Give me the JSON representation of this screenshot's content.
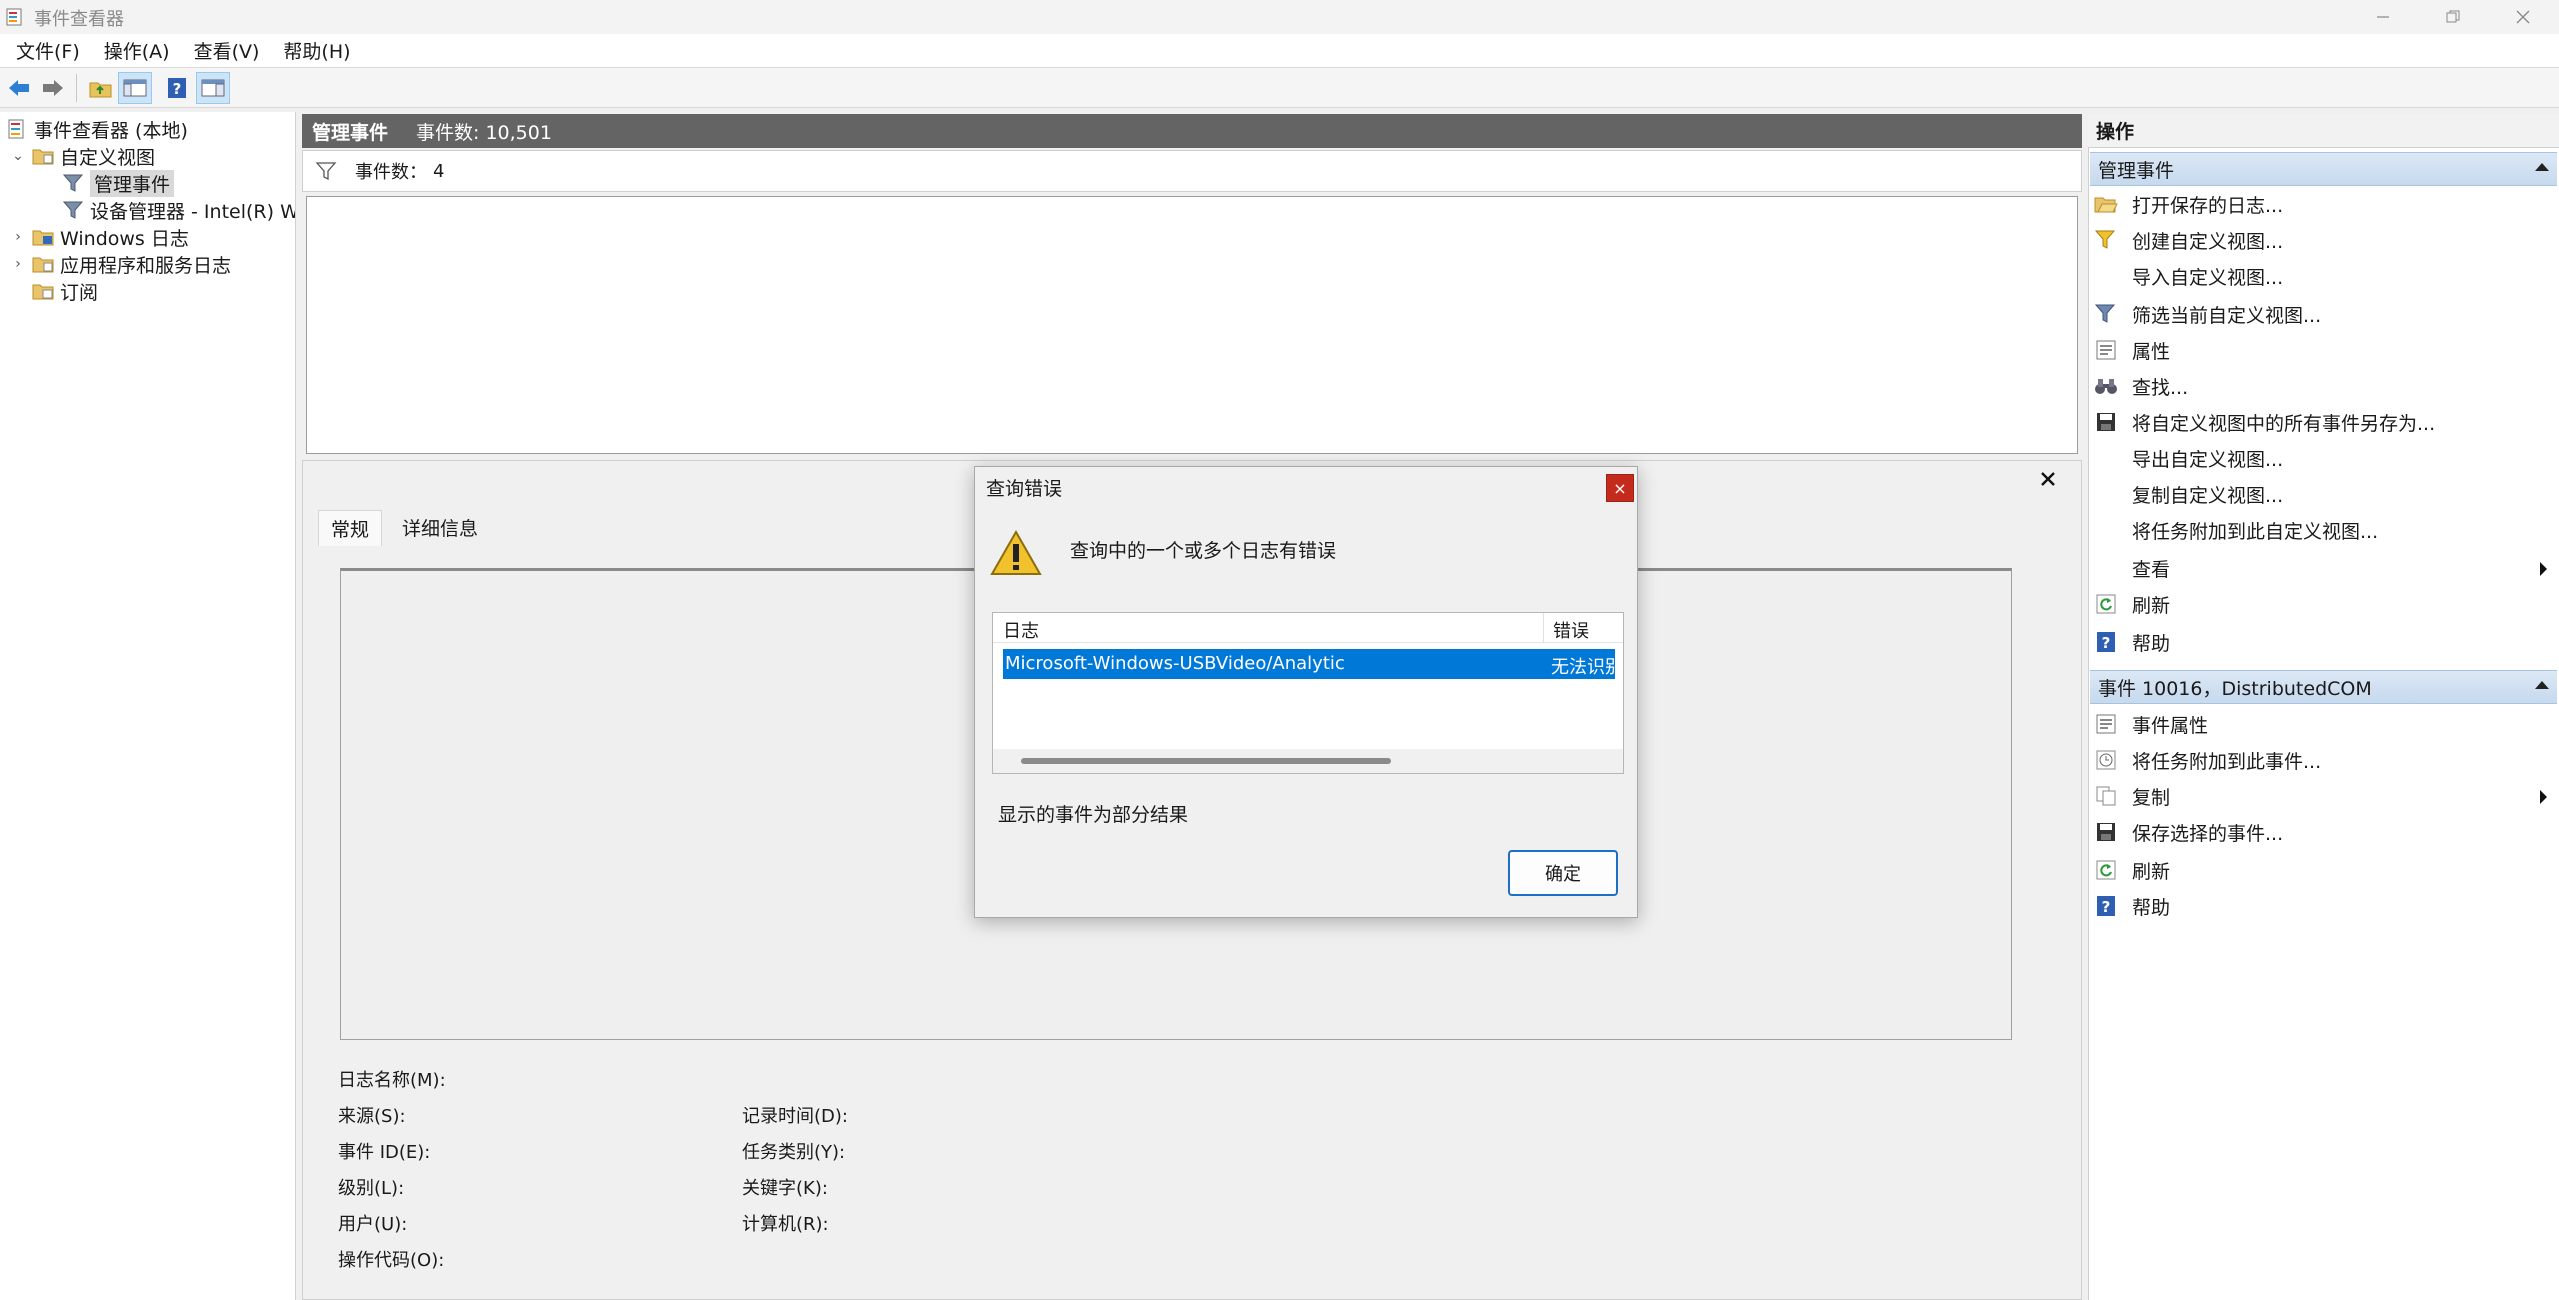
{
  "window": {
    "title": "事件查看器"
  },
  "menu": [
    "文件(F)",
    "操作(A)",
    "查看(V)",
    "帮助(H)"
  ],
  "tree": {
    "root": "事件查看器 (本地)",
    "custom_views": "自定义视图",
    "admin_events": "管理事件",
    "device_manager": "设备管理器 - Intel(R) Wi-",
    "windows_logs": "Windows 日志",
    "app_service_logs": "应用程序和服务日志",
    "subscriptions": "订阅"
  },
  "center": {
    "header_title": "管理事件",
    "header_count": "事件数: 10,501",
    "filter_label": "事件数：",
    "filter_count": "4"
  },
  "detail": {
    "tabs": [
      "常规",
      "详细信息"
    ],
    "fields": {
      "log_name": "日志名称(M):",
      "source": "来源(S):",
      "event_id": "事件 ID(E):",
      "level": "级别(L):",
      "user": "用户(U):",
      "opcode": "操作代码(O):",
      "logged": "记录时间(D):",
      "task_category": "任务类别(Y):",
      "keywords": "关键字(K):",
      "computer": "计算机(R):"
    }
  },
  "actions": {
    "title": "操作",
    "section1": "管理事件",
    "section1_items": [
      "打开保存的日志...",
      "创建自定义视图...",
      "导入自定义视图...",
      "筛选当前自定义视图...",
      "属性",
      "查找...",
      "将自定义视图中的所有事件另存为...",
      "导出自定义视图...",
      "复制自定义视图...",
      "将任务附加到此自定义视图...",
      "查看",
      "刷新",
      "帮助"
    ],
    "section2": "事件 10016，DistributedCOM",
    "section2_items": [
      "事件属性",
      "将任务附加到此事件...",
      "复制",
      "保存选择的事件...",
      "刷新",
      "帮助"
    ]
  },
  "dialog": {
    "title": "查询错误",
    "close": "×",
    "message": "查询中的一个或多个日志有错误",
    "col_log": "日志",
    "col_error": "错误",
    "row_log": "Microsoft-Windows-USBVideo/Analytic",
    "row_error": "无法识别",
    "partial": "显示的事件为部分结果",
    "ok": "确定"
  },
  "colors": {
    "selection": "#0078d7",
    "header_bar": "#646464",
    "section_bar": "#c6d9ee",
    "close_red": "#c42b1c"
  }
}
